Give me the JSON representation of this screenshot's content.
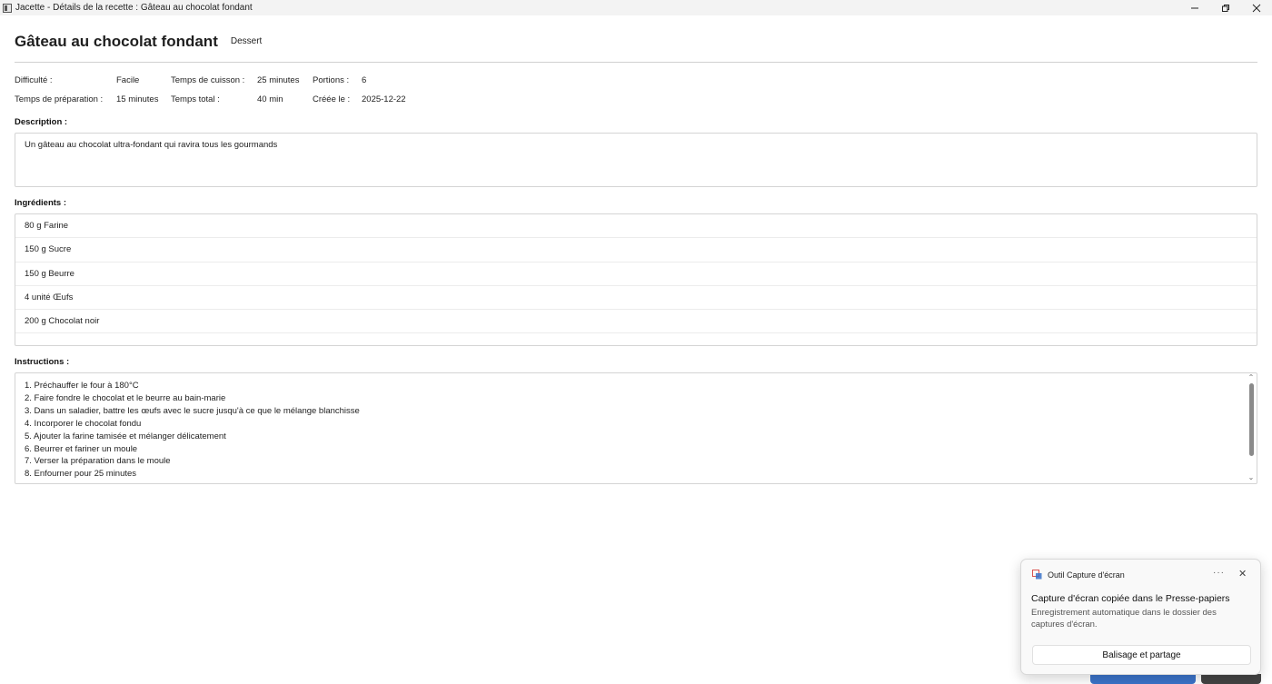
{
  "window": {
    "title": "Jacette - Détails de la recette : Gâteau au chocolat fondant"
  },
  "recipe": {
    "name": "Gâteau au chocolat fondant",
    "category": "Dessert",
    "meta": {
      "difficulty_label": "Difficulté :",
      "difficulty_value": "Facile",
      "cook_label": "Temps de cuisson :",
      "cook_value": "25 minutes",
      "portions_label": "Portions :",
      "portions_value": "6",
      "prep_label": "Temps de préparation :",
      "prep_value": "15 minutes",
      "total_label": "Temps total :",
      "total_value": "40 min",
      "created_label": "Créée le :",
      "created_value": "2025-12-22"
    },
    "description_label": "Description :",
    "description": "Un gâteau au chocolat ultra-fondant qui ravira tous les gourmands",
    "ingredients_label": "Ingrédients :",
    "ingredients": [
      "80 g Farine",
      "150 g Sucre",
      "150 g Beurre",
      "4 unité Œufs",
      "200 g Chocolat noir"
    ],
    "instructions_label": "Instructions :",
    "instructions": [
      "1. Préchauffer le four à 180°C",
      "2. Faire fondre le chocolat et le beurre au bain-marie",
      "3. Dans un saladier, battre les œufs avec le sucre jusqu'à ce que le mélange blanchisse",
      "4. Incorporer le chocolat fondu",
      "5. Ajouter la farine tamisée et mélanger délicatement",
      "6. Beurrer et fariner un moule",
      "7. Verser la préparation dans le moule",
      "8. Enfourner pour 25 minutes"
    ]
  },
  "toast": {
    "app_name": "Outil Capture d'écran",
    "title": "Capture d'écran copiée dans le Presse-papiers",
    "body": "Enregistrement automatique dans le dossier des captures d'écran.",
    "button": "Balisage et partage"
  }
}
